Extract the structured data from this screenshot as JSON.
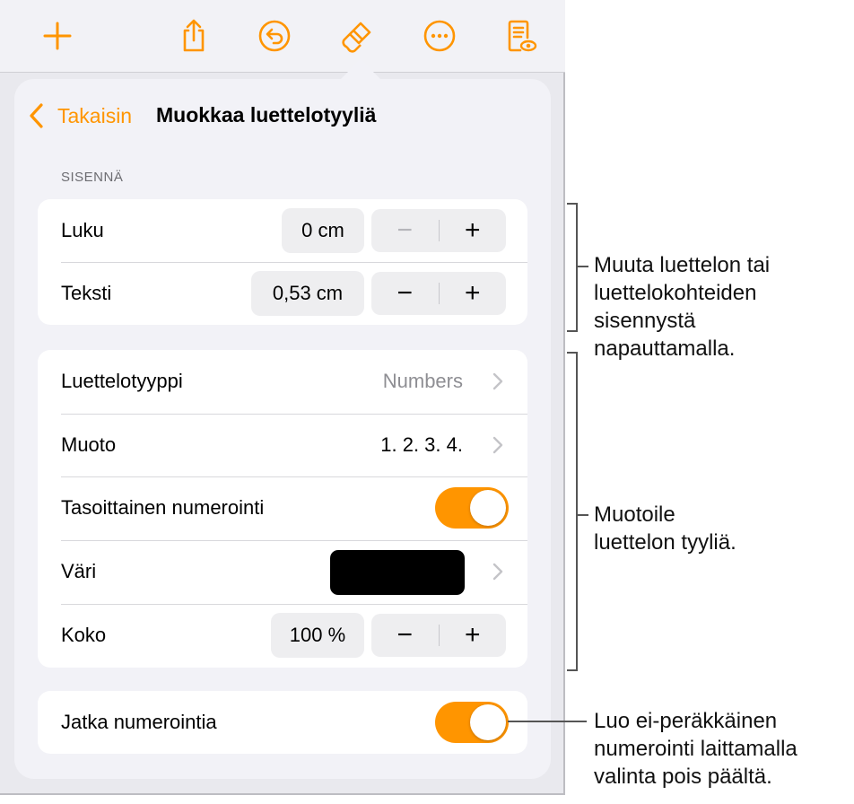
{
  "toolbar": {
    "icons": [
      "plus-icon",
      "share-icon",
      "undo-icon",
      "paintbrush-icon",
      "more-icon",
      "reader-view-icon"
    ]
  },
  "nav": {
    "back_label": "Takaisin",
    "title": "Muokkaa luettelotyyliä"
  },
  "indent": {
    "section_label": "SISENNÄ",
    "rows": [
      {
        "label": "Luku",
        "value": "0 cm",
        "minus": "−",
        "plus": "+"
      },
      {
        "label": "Teksti",
        "value": "0,53 cm",
        "minus": "−",
        "plus": "+"
      }
    ]
  },
  "style": {
    "list_type": {
      "label": "Luettelotyyppi",
      "value": "Numbers"
    },
    "format": {
      "label": "Muoto",
      "value": "1. 2. 3. 4."
    },
    "tiered": {
      "label": "Tasoittainen numerointi",
      "on": true
    },
    "color": {
      "label": "Väri",
      "swatch": "#000000"
    },
    "size": {
      "label": "Koko",
      "value": "100 %",
      "minus": "−",
      "plus": "+"
    }
  },
  "continue": {
    "label": "Jatka numerointia",
    "on": true
  },
  "colors": {
    "accent": "#ff9500"
  },
  "callouts": [
    {
      "lines": [
        "Muuta luettelon tai",
        "luettelokohteiden",
        "sisennystä",
        "napauttamalla."
      ]
    },
    {
      "lines": [
        "Muotoile",
        "luettelon tyyliä."
      ]
    },
    {
      "lines": [
        "Luo ei-peräkkäinen",
        "numerointi laittamalla",
        "valinta pois päältä."
      ]
    }
  ]
}
